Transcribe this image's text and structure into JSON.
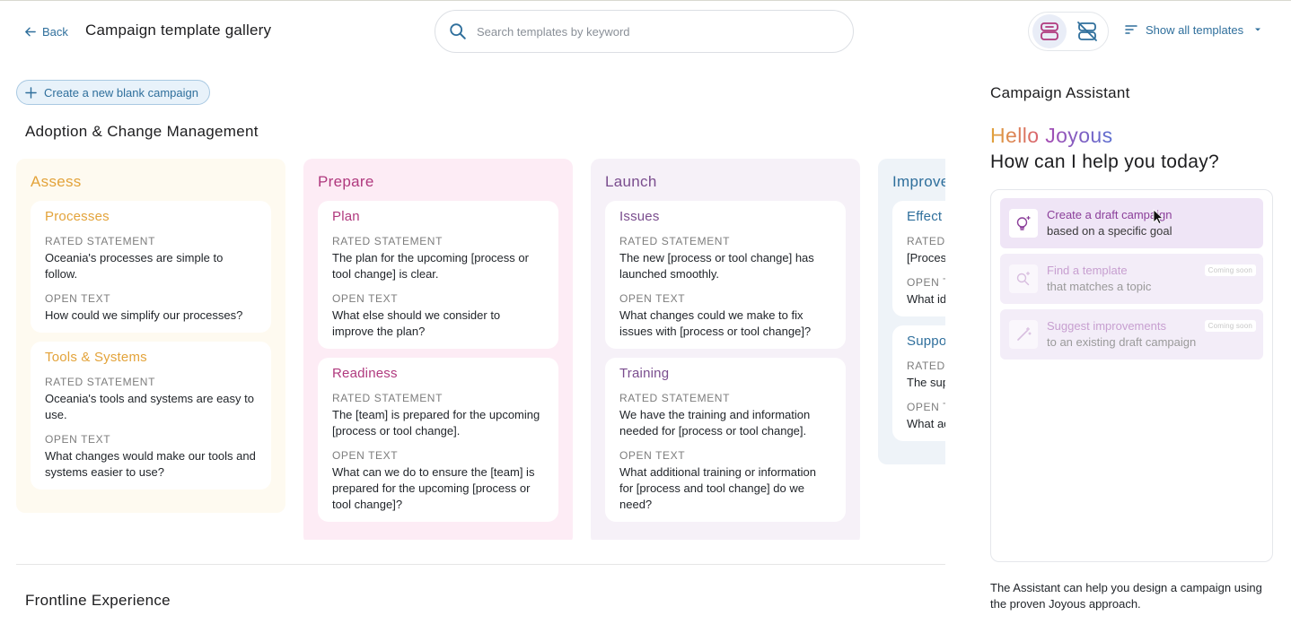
{
  "header": {
    "back_label": "Back",
    "title": "Campaign template gallery",
    "search_placeholder": "Search templates by keyword",
    "filter_label": "Show all templates",
    "view_icons": [
      "robot-assistant-icon",
      "assistant-off-icon"
    ]
  },
  "actions": {
    "create_label": "Create a new blank campaign"
  },
  "sections": [
    {
      "title": "Adoption & Change Management",
      "columns": [
        {
          "title": "Assess",
          "color": "#e3a33a",
          "bg": "#fefaf0",
          "cards": [
            {
              "title": "Processes",
              "rated_label": "RATED STATEMENT",
              "rated": "Oceania's processes are simple to follow.",
              "open_label": "OPEN TEXT",
              "open": "How could we simplify our processes?"
            },
            {
              "title": "Tools & Systems",
              "rated_label": "RATED STATEMENT",
              "rated": "Oceania's tools and systems are easy to use.",
              "open_label": "OPEN TEXT",
              "open": "What changes would make our tools and systems easier to use?"
            }
          ]
        },
        {
          "title": "Prepare",
          "color": "#b0397e",
          "bg": "#fdecf5",
          "cards": [
            {
              "title": "Plan",
              "rated_label": "RATED STATEMENT",
              "rated": "The plan for the upcoming [process or tool change] is clear.",
              "open_label": "OPEN TEXT",
              "open": "What else should we consider to improve the plan?"
            },
            {
              "title": "Readiness",
              "rated_label": "RATED STATEMENT",
              "rated": "The [team] is prepared for the upcoming [process or tool change].",
              "open_label": "OPEN TEXT",
              "open": "What can we do to ensure the [team] is prepared for the upcoming [process or tool change]?"
            }
          ]
        },
        {
          "title": "Launch",
          "color": "#7a4d8e",
          "bg": "#f6f1f8",
          "cards": [
            {
              "title": "Issues",
              "rated_label": "RATED STATEMENT",
              "rated": "The new [process or tool change] has launched smoothly.",
              "open_label": "OPEN TEXT",
              "open": "What changes could we make to fix issues with [process or tool change]?"
            },
            {
              "title": "Training",
              "rated_label": "RATED STATEMENT",
              "rated": "We have the training and information needed for [process or tool change].",
              "open_label": "OPEN TEXT",
              "open": "What additional training or information for [process and tool change] do we need?"
            }
          ]
        },
        {
          "title": "Improve",
          "color": "#2f6f9c",
          "bg": "#eef3f8",
          "cards": [
            {
              "title": "Effect",
              "rated_label": "RATED",
              "rated": "[Proces [achiev",
              "open_label": "OPEN T",
              "open": "What id [proces"
            },
            {
              "title": "Suppo",
              "rated_label": "RATED",
              "rated": "The sup tool cha",
              "open_label": "OPEN T",
              "open": "What ac conside change"
            }
          ]
        }
      ]
    },
    {
      "title": "Frontline Experience"
    }
  ],
  "assistant": {
    "title": "Campaign Assistant",
    "greeting_word": "Hello",
    "greeting_name": "Joyous",
    "question": "How can I help you today?",
    "options": [
      {
        "line1": "Create a draft campaign",
        "line2": "based on a specific goal",
        "badge": "",
        "icon": "lightbulb-sparkle-icon"
      },
      {
        "line1": "Find a template",
        "line2": "that matches a topic",
        "badge": "Coming soon",
        "icon": "search-sparkle-icon"
      },
      {
        "line1": "Suggest improvements",
        "line2": "to an existing draft campaign",
        "badge": "Coming soon",
        "icon": "magic-wand-icon"
      }
    ],
    "footer": "The Assistant can help you design a campaign using the proven Joyous approach."
  }
}
